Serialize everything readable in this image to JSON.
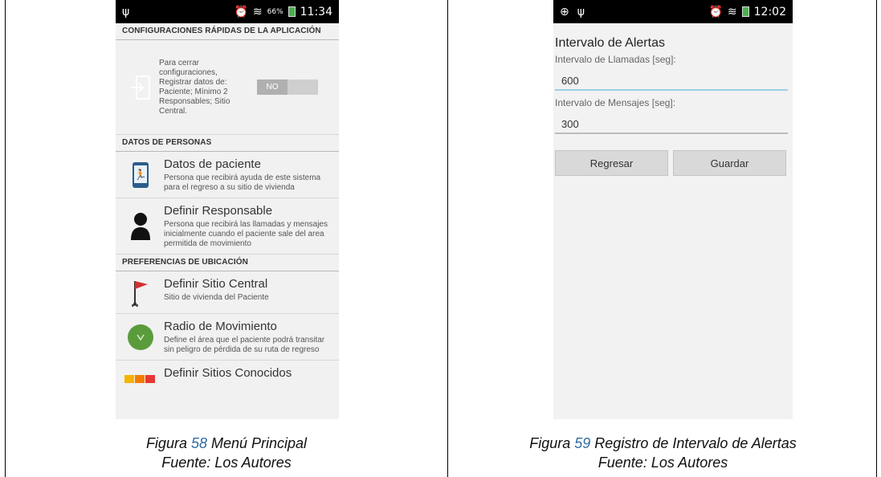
{
  "phone1": {
    "status": {
      "left_icons": "ψ",
      "pct": "66%",
      "time": "11:34"
    },
    "sections": {
      "quick_settings": "CONFIGURACIONES RÁPIDAS DE LA APLICACIÓN",
      "people": "DATOS DE PERSONAS",
      "location": "PREFERENCIAS DE UBICACIÓN"
    },
    "quick_setting": {
      "text": "Para cerrar configuraciones, Registrar datos de: Paciente; Mínimo 2 Responsables; Sitio Central.",
      "toggle_label": "NO"
    },
    "items": [
      {
        "title": "Datos de paciente",
        "desc": "Persona que recibirá ayuda de este sistema para el regreso a su sitio de vivienda"
      },
      {
        "title": "Definir Responsable",
        "desc": "Persona que recibirá las llamadas y mensajes inicialmente cuando el paciente sale del area permitida de movimiento"
      },
      {
        "title": "Definir Sitio Central",
        "desc": "Sitio de vivienda del Paciente"
      },
      {
        "title": "Radio de Movimiento",
        "desc": "Define el área que el paciente podrá transitar sin peligro de pérdida de su ruta de regreso"
      },
      {
        "title": "Definir Sitios Conocidos",
        "desc": ""
      }
    ]
  },
  "phone2": {
    "status": {
      "time": "12:02"
    },
    "title": "Intervalo de Alertas",
    "calls_label": "Intervalo de Llamadas [seg]:",
    "calls_value": "600",
    "msgs_label": "Intervalo de Mensajes [seg]:",
    "msgs_value": "300",
    "back_button": "Regresar",
    "save_button": "Guardar"
  },
  "captions": {
    "left": {
      "prefix": "Figura ",
      "number": "58",
      "text": " Menú Principal",
      "source": "Fuente: Los Autores"
    },
    "right": {
      "prefix": "Figura ",
      "number": "59",
      "text": " Registro de Intervalo de Alertas",
      "source": "Fuente: Los Autores"
    }
  }
}
